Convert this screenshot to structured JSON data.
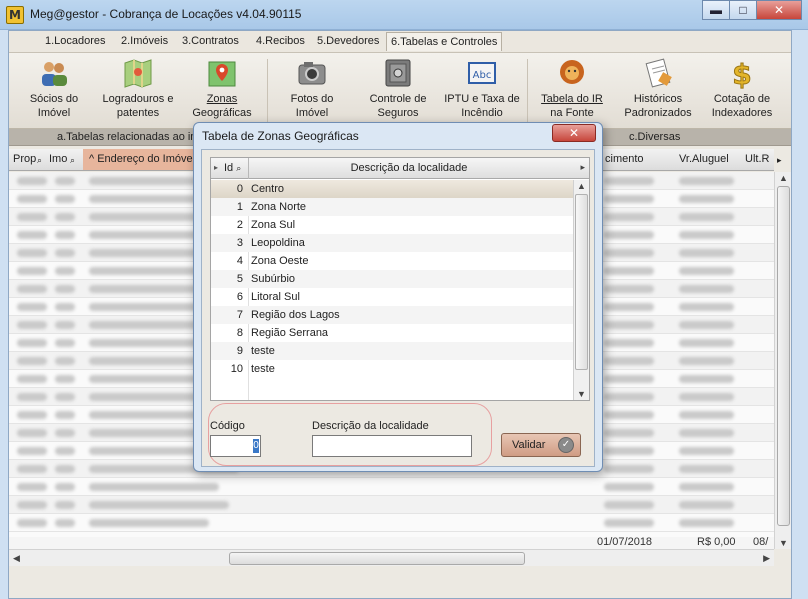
{
  "window": {
    "title": "Meg@gestor - Cobrança de Locações v4.04.90115",
    "icon": "M",
    "controls": {
      "minimize": "▬",
      "maximize": "□",
      "close": "✕"
    }
  },
  "menu": [
    {
      "label": "1.Locadores"
    },
    {
      "label": "2.Imóveis"
    },
    {
      "label": "3.Contratos"
    },
    {
      "label": "4.Recibos"
    },
    {
      "label": "5.Devedores"
    },
    {
      "label": "6.Tabelas e Controles",
      "active": true
    }
  ],
  "toolbar": {
    "tools": [
      {
        "line1": "Sócios do",
        "line2": "Imóvel",
        "icon": "people-icon"
      },
      {
        "line1": "Logradouros e",
        "line2": "patentes",
        "icon": "map-icon"
      },
      {
        "line1": "Zonas",
        "line2": "Geográficas",
        "icon": "map-pin-icon"
      },
      {
        "line1": "Fotos do",
        "line2": "Imóvel",
        "icon": "camera-icon"
      },
      {
        "line1": "Controle de",
        "line2": "Seguros",
        "icon": "safe-icon"
      },
      {
        "line1": "IPTU e Taxa de",
        "line2": "Incêndio",
        "icon": "abc-icon"
      },
      {
        "line1": "Tabela do IR",
        "line2": "na Fonte",
        "icon": "lion-icon"
      },
      {
        "line1": "Históricos",
        "line2": "Padronizados",
        "icon": "document-icon"
      },
      {
        "line1": "Cotação de",
        "line2": "Indexadores",
        "icon": "dollar-icon"
      }
    ],
    "groups": {
      "a": "a.Tabelas relacionadas ao im",
      "c": "c.Diversas"
    }
  },
  "grid": {
    "headers": {
      "prop": "Prop",
      "imo": "Imo",
      "endereco": "Endereço do Imóvel",
      "vencimento": "cimento",
      "valor": "Vr.Aluguel",
      "ultimo": "Ult.R"
    },
    "footer": {
      "date": "01/07/2018",
      "amount": "R$ 0,00",
      "last": "08/"
    }
  },
  "dialog": {
    "title": "Tabela de Zonas Geográficas",
    "close": "✕",
    "columns": {
      "id": "Id",
      "description": "Descrição da localidade"
    },
    "rows": [
      {
        "id": "0",
        "description": "Centro"
      },
      {
        "id": "1",
        "description": "Zona Norte"
      },
      {
        "id": "2",
        "description": "Zona Sul"
      },
      {
        "id": "3",
        "description": "Leopoldina"
      },
      {
        "id": "4",
        "description": "Zona Oeste"
      },
      {
        "id": "5",
        "description": "Subúrbio"
      },
      {
        "id": "6",
        "description": "Litoral Sul"
      },
      {
        "id": "7",
        "description": "Região dos Lagos"
      },
      {
        "id": "8",
        "description": "Região Serrana"
      },
      {
        "id": "9",
        "description": "teste"
      },
      {
        "id": "10",
        "description": "teste"
      }
    ],
    "form": {
      "code_label": "Código",
      "code_value": "0",
      "description_label": "Descrição da localidade",
      "description_value": "",
      "submit_label": "Validar"
    }
  }
}
